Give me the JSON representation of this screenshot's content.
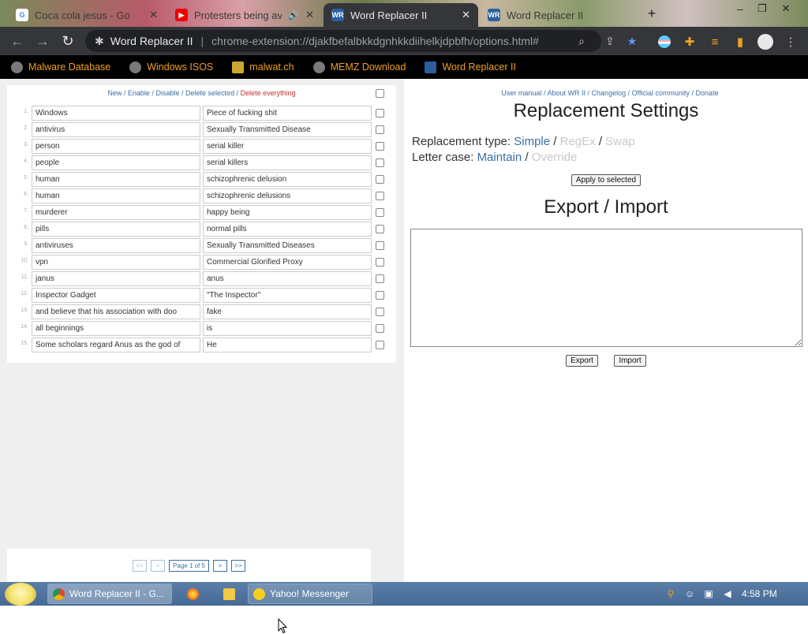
{
  "browser": {
    "tabs": [
      {
        "title": "Coca cola jesus - Google",
        "active": false
      },
      {
        "title": "Protesters being ava",
        "active": false
      },
      {
        "title": "Word Replacer II",
        "active": true
      },
      {
        "title": "Word Replacer II",
        "active": false
      }
    ],
    "omnibox": {
      "site": "Word Replacer II",
      "url": "chrome-extension://djakfbefalbkkdgnhkkdiihelkjdpbfh/options.html#"
    },
    "bookmarks": [
      "Malware Database",
      "Windows ISOS",
      "malwat.ch",
      "MEMZ Download",
      "Word Replacer II"
    ]
  },
  "list": {
    "actions": {
      "new": "New",
      "enable": "Enable",
      "disable": "Disable",
      "delete_selected": "Delete selected",
      "delete_all": "Delete everything",
      "sep": "/"
    },
    "rows": [
      {
        "n": "1.",
        "find": "Windows",
        "replace": "Piece of fucking shit"
      },
      {
        "n": "2.",
        "find": "antivirus",
        "replace": "Sexually Transmitted Disease"
      },
      {
        "n": "3.",
        "find": "person",
        "replace": "serial killer"
      },
      {
        "n": "4.",
        "find": "people",
        "replace": "serial killers"
      },
      {
        "n": "5.",
        "find": "human",
        "replace": "schizophrenic delusion"
      },
      {
        "n": "6.",
        "find": "human",
        "replace": "schizophrenic delusions"
      },
      {
        "n": "7.",
        "find": "murderer",
        "replace": "happy being"
      },
      {
        "n": "8.",
        "find": "pills",
        "replace": "normal pills"
      },
      {
        "n": "9.",
        "find": "antiviruses",
        "replace": "Sexually Transmitted Diseases"
      },
      {
        "n": "10.",
        "find": "vpn",
        "replace": "Commercial Glorified Proxy"
      },
      {
        "n": "11.",
        "find": "janus",
        "replace": "anus"
      },
      {
        "n": "12.",
        "find": "Inspector Gadget",
        "replace": "\"The Inspector\""
      },
      {
        "n": "13.",
        "find": "and believe that his association with doo",
        "replace": "fake"
      },
      {
        "n": "14.",
        "find": "all beginnings",
        "replace": "is"
      },
      {
        "n": "15.",
        "find": "Some scholars regard Anus as the god of",
        "replace": "He"
      }
    ],
    "pager": {
      "first": "<<",
      "prev": "<",
      "page_label": "Page 1 of 5",
      "next": ">",
      "last": ">>"
    }
  },
  "settings": {
    "top_links": {
      "manual": "User manual",
      "about": "About WR II",
      "changelog": "Changelog",
      "community": "Official community",
      "donate": "Donate",
      "sep": "/"
    },
    "title": "Replacement Settings",
    "replacement_type": {
      "label": "Replacement type:",
      "options": [
        "Simple",
        "RegEx",
        "Swap"
      ],
      "selected": "Simple"
    },
    "letter_case": {
      "label": "Letter case:",
      "options": [
        "Maintain",
        "Override"
      ],
      "selected": "Maintain"
    },
    "apply_label": "Apply to selected",
    "export_title": "Export / Import",
    "export_text": "",
    "export_label": "Export",
    "import_label": "Import"
  },
  "taskbar": {
    "tasks": [
      "Word Replacer II - G...",
      "Yahoo! Messenger"
    ],
    "clock": "4:58 PM"
  }
}
